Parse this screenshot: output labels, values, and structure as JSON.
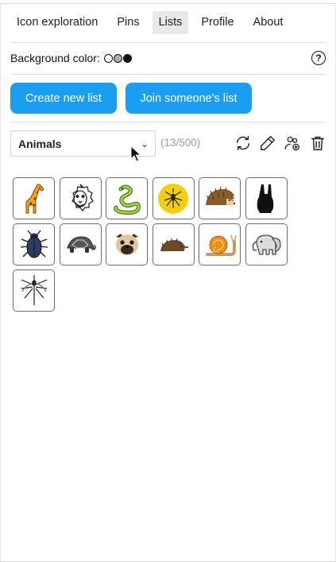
{
  "nav": {
    "tabs": [
      {
        "label": "Icon exploration",
        "active": false
      },
      {
        "label": "Pins",
        "active": false
      },
      {
        "label": "Lists",
        "active": true
      },
      {
        "label": "Profile",
        "active": false
      },
      {
        "label": "About",
        "active": false
      }
    ]
  },
  "background": {
    "label": "Background color:",
    "swatches": [
      "#ffffff",
      "#b0b0b0",
      "#111111"
    ],
    "help_icon": "question-circle-icon"
  },
  "buttons": {
    "create_label": "Create new list",
    "join_label": "Join someone's list",
    "color": "#1a9ff0"
  },
  "list": {
    "selected": "Animals",
    "count": "(13/500)",
    "actions": [
      "refresh-icon",
      "edit-icon",
      "share-users-icon",
      "trash-icon"
    ]
  },
  "icons": [
    "giraffe-icon",
    "lion-icon",
    "snake-icon",
    "mosquito-badge-icon",
    "hedgehog-icon",
    "rabbit-silhouette-icon",
    "beetle-icon",
    "turtle-icon",
    "pug-icon",
    "hedgehog-small-icon",
    "snail-icon",
    "elephant-icon",
    "mosquito-icon"
  ]
}
